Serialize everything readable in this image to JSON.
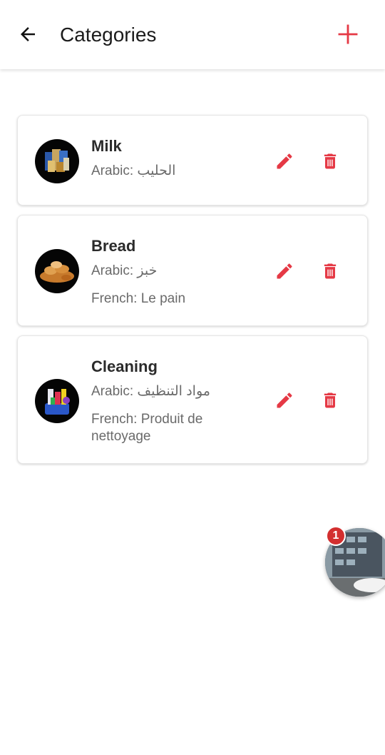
{
  "header": {
    "title": "Categories",
    "back_icon": "arrow-left-icon",
    "add_icon": "plus-icon"
  },
  "colors": {
    "accent": "#e53945",
    "text_primary": "#2b2b2b",
    "text_secondary": "#6a6a6a",
    "badge": "#d32f2f"
  },
  "categories": [
    {
      "name": "Milk",
      "arabic": "Arabic: الحليب",
      "french": ""
    },
    {
      "name": "Bread",
      "arabic": "Arabic: خبز",
      "french": "French: Le pain"
    },
    {
      "name": "Cleaning",
      "arabic": "Arabic: مواد التنظيف",
      "french": "French: Produit de nettoyage"
    }
  ],
  "chat_head": {
    "badge_count": "1"
  }
}
